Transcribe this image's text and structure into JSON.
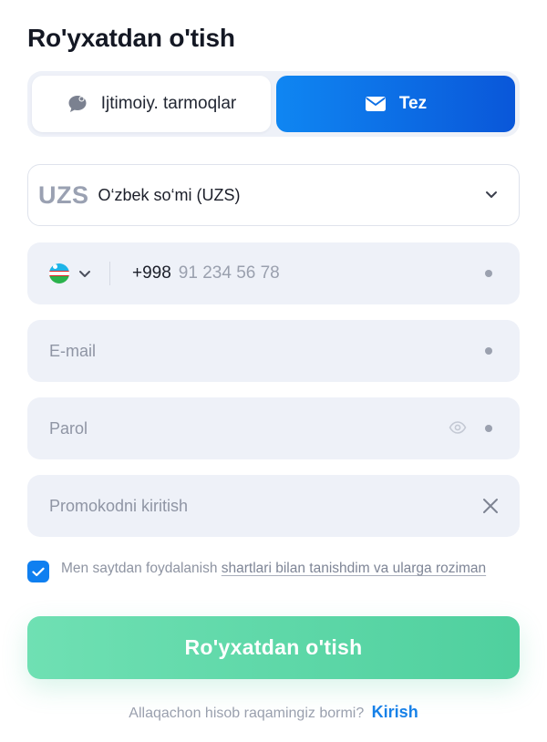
{
  "page": {
    "title": "Ro'yxatdan o'tish"
  },
  "tabs": [
    {
      "label": "Ijtimoiy. tarmoqlar",
      "icon": "chat-bubble-icon",
      "active": false
    },
    {
      "label": "Tez",
      "icon": "envelope-icon",
      "active": true
    }
  ],
  "currency": {
    "code": "UZS",
    "name": "O‘zbek so‘mi (UZS)"
  },
  "phone": {
    "country": "Uzbekistan",
    "prefix": "+998",
    "placeholder": "91 234 56 78"
  },
  "email": {
    "placeholder": "E-mail"
  },
  "password": {
    "placeholder": "Parol"
  },
  "promo": {
    "placeholder": "Promokodni kiritish"
  },
  "agreement": {
    "checked": true,
    "text": "Men saytdan foydalanish ",
    "link": "shartlari bilan tanishdim va ularga roziman"
  },
  "submit": {
    "label": "Ro'yxatdan o'tish"
  },
  "login": {
    "question": "Allaqachon hisob raqamingiz bormi?",
    "link": "Kirish"
  },
  "colors": {
    "accent": "#0a6ee6",
    "submit": "#5ad6a6",
    "field_bg": "#eef1f8",
    "link": "#1781e8"
  }
}
